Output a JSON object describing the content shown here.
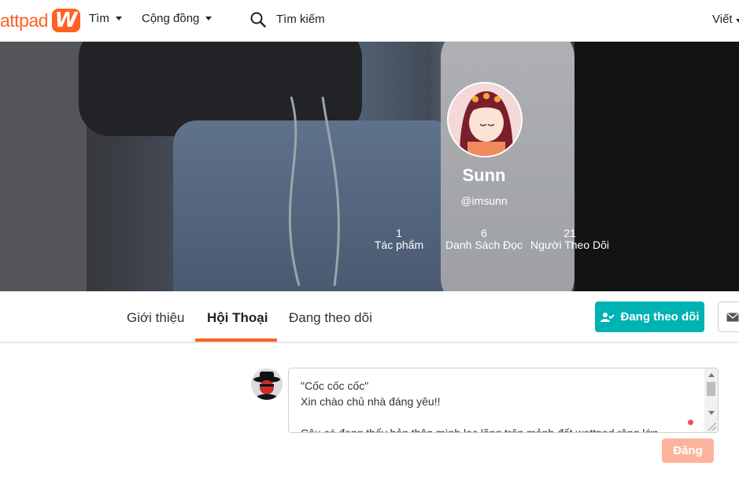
{
  "nav": {
    "logo_text": "attpad",
    "logo_mark": "W",
    "browse_label": "Tìm",
    "community_label": "Cộng đồng",
    "search_placeholder": "Tìm kiếm",
    "write_label": "Viết"
  },
  "profile": {
    "display_name": "Sunn",
    "handle": "@imsunn",
    "stats": [
      {
        "value": "1",
        "label": "Tác phẩm"
      },
      {
        "value": "6",
        "label": "Danh Sách Đọc"
      },
      {
        "value": "21",
        "label": "Người Theo Dõi"
      }
    ]
  },
  "tabs": {
    "about": "Giới thiệu",
    "conversations": "Hội Thoại",
    "following": "Đang theo dõi",
    "follow_button": "Đang theo dõi"
  },
  "composer": {
    "text": "\"Cốc cốc cốc\"\nXin chào chủ nhà đáng yêu!!\n\nCậu có đang thấy bản thân mình lạc lõng trên mảnh đất wattpad rộng lớn",
    "post_button": "Đăng"
  },
  "colors": {
    "brand": "#ff6122",
    "follow_teal": "#00b2b2",
    "post_disabled": "#fbb49b"
  }
}
